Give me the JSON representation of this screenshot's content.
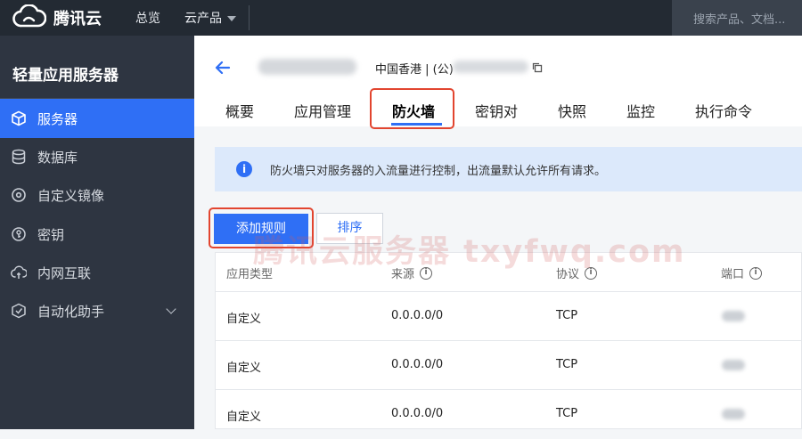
{
  "topbar": {
    "brand": "腾讯云",
    "nav_overview": "总览",
    "nav_products": "云产品",
    "search_placeholder": "搜索产品、文档..."
  },
  "sidebar": {
    "title": "轻量应用服务器",
    "items": [
      {
        "label": "服务器",
        "icon": "cube-icon",
        "active": true
      },
      {
        "label": "数据库",
        "icon": "database-icon",
        "active": false
      },
      {
        "label": "自定义镜像",
        "icon": "disc-icon",
        "active": false
      },
      {
        "label": "密钥",
        "icon": "key-icon",
        "active": false
      },
      {
        "label": "内网互联",
        "icon": "network-icon",
        "active": false
      },
      {
        "label": "自动化助手",
        "icon": "automation-icon",
        "active": false
      }
    ]
  },
  "header": {
    "region": "中国香港 | (公)",
    "tabs": [
      {
        "label": "概要"
      },
      {
        "label": "应用管理"
      },
      {
        "label": "防火墙",
        "active": true
      },
      {
        "label": "密钥对"
      },
      {
        "label": "快照"
      },
      {
        "label": "监控"
      },
      {
        "label": "执行命令"
      }
    ]
  },
  "notice": {
    "text": "防火墙只对服务器的入流量进行控制，出流量默认允许所有请求。"
  },
  "actions": {
    "add_rule": "添加规则",
    "sort": "排序"
  },
  "watermark": "腾讯云服务器 txyfwq.com",
  "table": {
    "columns": [
      "应用类型",
      "来源",
      "协议",
      "端口"
    ],
    "rows": [
      {
        "type": "自定义",
        "source": "0.0.0.0/0",
        "protocol": "TCP"
      },
      {
        "type": "自定义",
        "source": "0.0.0.0/0",
        "protocol": "TCP"
      },
      {
        "type": "自定义",
        "source": "0.0.0.0/0",
        "protocol": "TCP"
      }
    ]
  },
  "colors": {
    "accent": "#2f6ff5",
    "highlight": "#e2452f",
    "topbar": "#232a33",
    "sidebar": "#2e3541"
  }
}
